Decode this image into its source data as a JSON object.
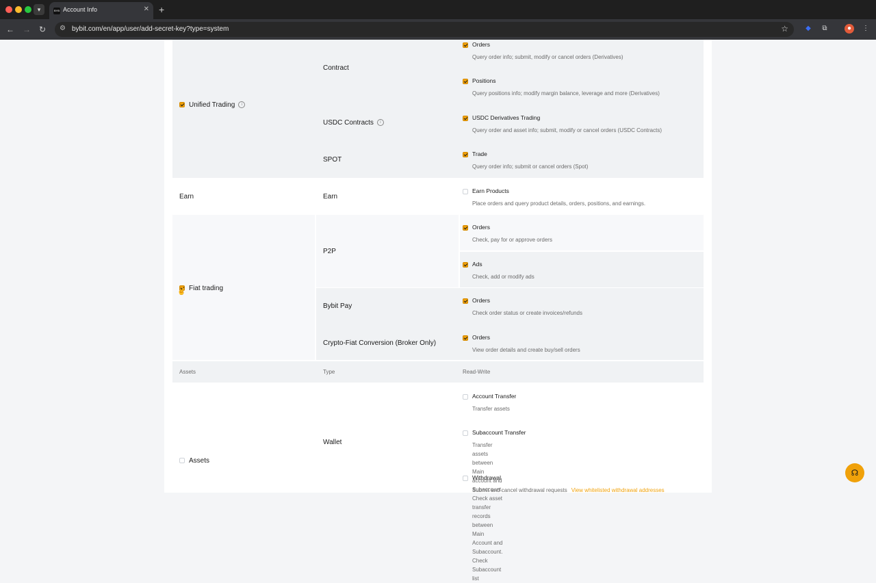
{
  "browser": {
    "tab_title": "Account Info",
    "tab_favicon": "BYB",
    "url": "bybit.com/en/app/user/add-secret-key?type=system"
  },
  "sections": [
    {
      "category": "Unified Trading",
      "checked": true,
      "info": true,
      "bg": "gray2",
      "types": [
        {
          "type": "Contract",
          "perms": [
            {
              "name": "Orders",
              "desc": "Query order info; submit, modify or cancel orders (Derivatives)",
              "checked": true
            },
            {
              "name": "Positions",
              "desc": "Query positions info; modify margin balance, leverage and more (Derivatives)",
              "checked": true
            }
          ]
        },
        {
          "type": "USDC Contracts",
          "info": true,
          "perms": [
            {
              "name": "USDC Derivatives Trading",
              "desc": "Query order and asset info; submit, modify or cancel orders (USDC Contracts)",
              "checked": true
            }
          ]
        },
        {
          "type": "SPOT",
          "perms": [
            {
              "name": "Trade",
              "desc": "Query order info; submit or cancel orders (Spot)",
              "checked": true
            }
          ]
        }
      ]
    },
    {
      "category": "Earn",
      "checked": null,
      "bg": "white",
      "types": [
        {
          "type": "Earn",
          "perms": [
            {
              "name": "Earn Products",
              "desc": "Place orders and query product details, orders, positions, and earnings.",
              "checked": false
            }
          ]
        }
      ]
    },
    {
      "category": "Fiat trading",
      "checked": true,
      "bg": "gray",
      "types": [
        {
          "type": "P2P",
          "perms": [
            {
              "name": "Orders",
              "desc": "Check, pay for or approve orders",
              "checked": true
            },
            {
              "name": "Ads",
              "desc": "Check, add or modify ads",
              "checked": true
            }
          ]
        },
        {
          "type": "Bybit Pay",
          "perms": [
            {
              "name": "Orders",
              "desc": "Check order status or create invoices/refunds",
              "checked": true
            }
          ]
        },
        {
          "type": "Crypto-Fiat Conversion (Broker Only)",
          "perms": [
            {
              "name": "Orders",
              "desc": "View order details and create buy/sell orders",
              "checked": true
            }
          ]
        }
      ]
    }
  ],
  "assets_header": {
    "col1": "Assets",
    "col2": "Type",
    "col3": "Read-Write"
  },
  "assets": {
    "category": "Assets",
    "checked": false,
    "type": "Wallet",
    "perms": [
      {
        "name": "Account Transfer",
        "desc": "Transfer assets",
        "checked": false
      },
      {
        "name": "Subaccount Transfer",
        "desc": "Transfer assets between Main account and Subaccount. Check asset transfer records\nbetween Main Account and Subaccount. Check Subaccount list",
        "checked": false
      },
      {
        "name": "Withdrawal",
        "desc": "Submit and cancel withdrawal requests",
        "link": "View whitelisted withdrawal addresses",
        "checked": false
      }
    ]
  },
  "colors": {
    "accent": "#f0a10a",
    "gray_row": "#f0f2f4"
  },
  "support_icon": "headset-icon"
}
